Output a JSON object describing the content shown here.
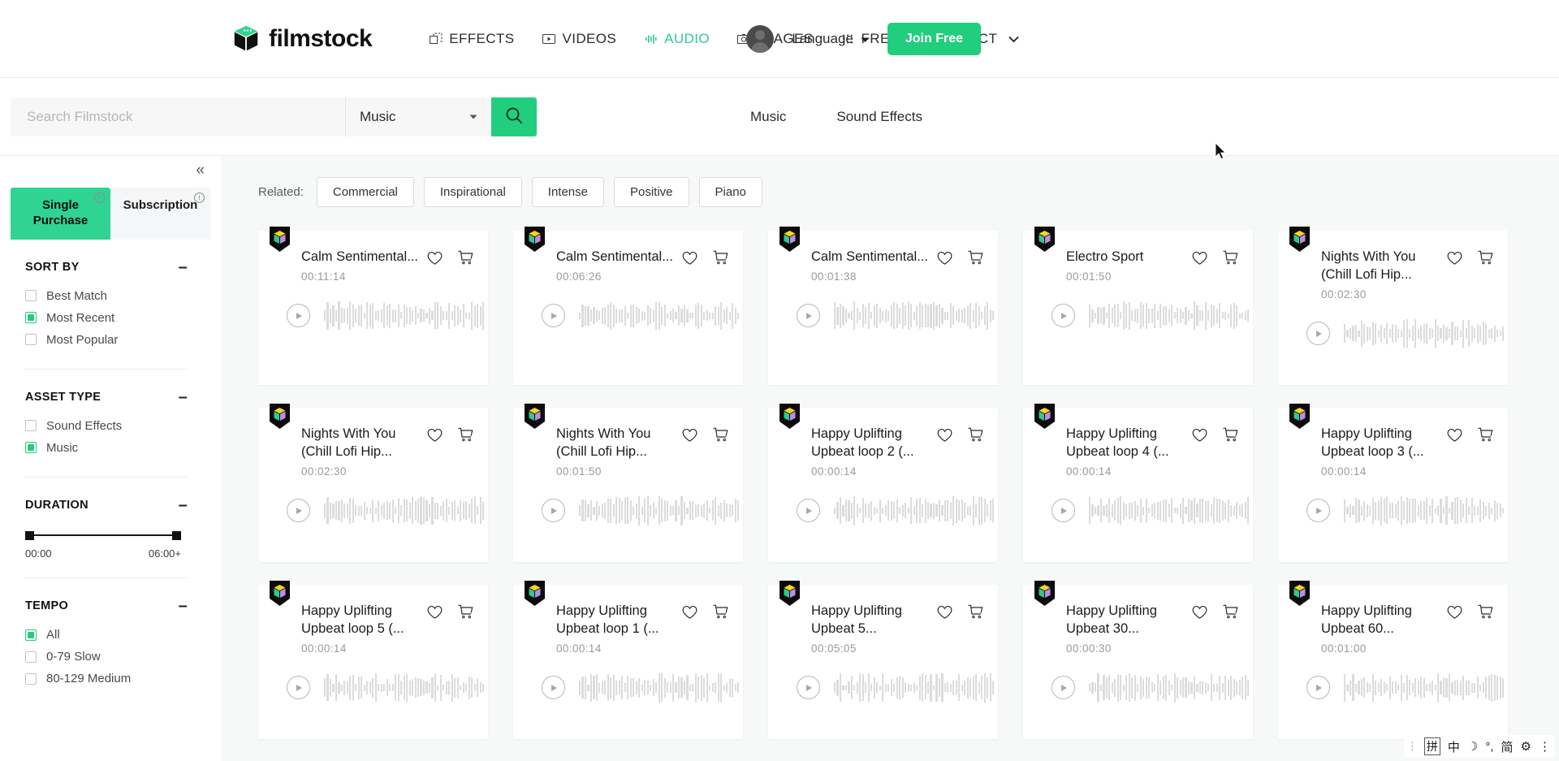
{
  "header": {
    "brand": "filmstock",
    "brand_icon": "cube-logo-icon",
    "nav": [
      {
        "label": "EFFECTS",
        "icon": "effects-icon",
        "active": false
      },
      {
        "label": "VIDEOS",
        "icon": "video-play-icon",
        "active": false
      },
      {
        "label": "AUDIO",
        "icon": "audio-wave-icon",
        "active": true
      },
      {
        "label": "IMAGES",
        "icon": "image-camera-icon",
        "active": false
      },
      {
        "label": "FREE",
        "icon": "grid-dots-icon",
        "active": false
      },
      {
        "label": "PRODUCT",
        "icon": "chevron-down-icon",
        "active": false
      }
    ],
    "language_label": "Language",
    "join_label": "Join Free",
    "accent_color": "#21ce7e"
  },
  "search": {
    "placeholder": "Search Filmstock",
    "value": "",
    "category": "Music",
    "icon": "search-icon",
    "subtabs": [
      {
        "label": "Music"
      },
      {
        "label": "Sound Effects"
      }
    ]
  },
  "sidebar": {
    "collapse_icon": "chevron-double-left-icon",
    "plan_tabs": [
      {
        "label": "Single Purchase",
        "active": true,
        "info": "i"
      },
      {
        "label": "Subscription",
        "active": false,
        "info": "i"
      }
    ],
    "sections": [
      {
        "title": "SORT BY",
        "collapse": "minus-icon",
        "options": [
          {
            "label": "Best Match",
            "checked": false
          },
          {
            "label": "Most Recent",
            "checked": true
          },
          {
            "label": "Most Popular",
            "checked": false
          }
        ]
      },
      {
        "title": "ASSET TYPE",
        "collapse": "minus-icon",
        "options": [
          {
            "label": "Sound Effects",
            "checked": false
          },
          {
            "label": "Music",
            "checked": true
          }
        ]
      },
      {
        "title": "DURATION",
        "collapse": "minus-icon",
        "slider": {
          "min_label": "00:00",
          "max_label": "06:00+"
        }
      },
      {
        "title": "TEMPO",
        "collapse": "minus-icon",
        "options": [
          {
            "label": "All",
            "checked": true
          },
          {
            "label": "0-79 Slow",
            "checked": false
          },
          {
            "label": "80-129 Medium",
            "checked": false
          }
        ]
      }
    ]
  },
  "main": {
    "related_label": "Related:",
    "related_tags": [
      "Commercial",
      "Inspirational",
      "Intense",
      "Positive",
      "Piano"
    ],
    "card_icons": {
      "favorite": "heart-icon",
      "cart": "cart-icon",
      "play": "play-icon",
      "badge": "cube-badge-icon"
    },
    "cards": [
      {
        "title": "Calm Sentimental...",
        "duration": "00:11:14"
      },
      {
        "title": "Calm Sentimental...",
        "duration": "00:06:26"
      },
      {
        "title": "Calm Sentimental...",
        "duration": "00:01:38"
      },
      {
        "title": "Electro Sport",
        "duration": "00:01:50"
      },
      {
        "title": "Nights With You (Chill Lofi Hip...",
        "duration": "00:02:30"
      },
      {
        "title": "Nights With You (Chill Lofi Hip...",
        "duration": "00:02:30"
      },
      {
        "title": "Nights With You (Chill Lofi Hip...",
        "duration": "00:01:50"
      },
      {
        "title": "Happy Uplifting Upbeat loop 2 (...",
        "duration": "00:00:14"
      },
      {
        "title": "Happy Uplifting Upbeat loop 4 (...",
        "duration": "00:00:14"
      },
      {
        "title": "Happy Uplifting Upbeat loop 3 (...",
        "duration": "00:00:14"
      },
      {
        "title": "Happy Uplifting Upbeat loop 5 (...",
        "duration": "00:00:14"
      },
      {
        "title": "Happy Uplifting Upbeat loop 1 (...",
        "duration": "00:00:14"
      },
      {
        "title": "Happy Uplifting Upbeat 5...",
        "duration": "00:05:05"
      },
      {
        "title": "Happy Uplifting Upbeat 30...",
        "duration": "00:00:30"
      },
      {
        "title": "Happy Uplifting Upbeat 60...",
        "duration": "00:01:00"
      }
    ]
  },
  "ime": {
    "items": [
      "拼",
      "中",
      "☽",
      "°,",
      "简",
      "⚙",
      "⋮"
    ]
  }
}
